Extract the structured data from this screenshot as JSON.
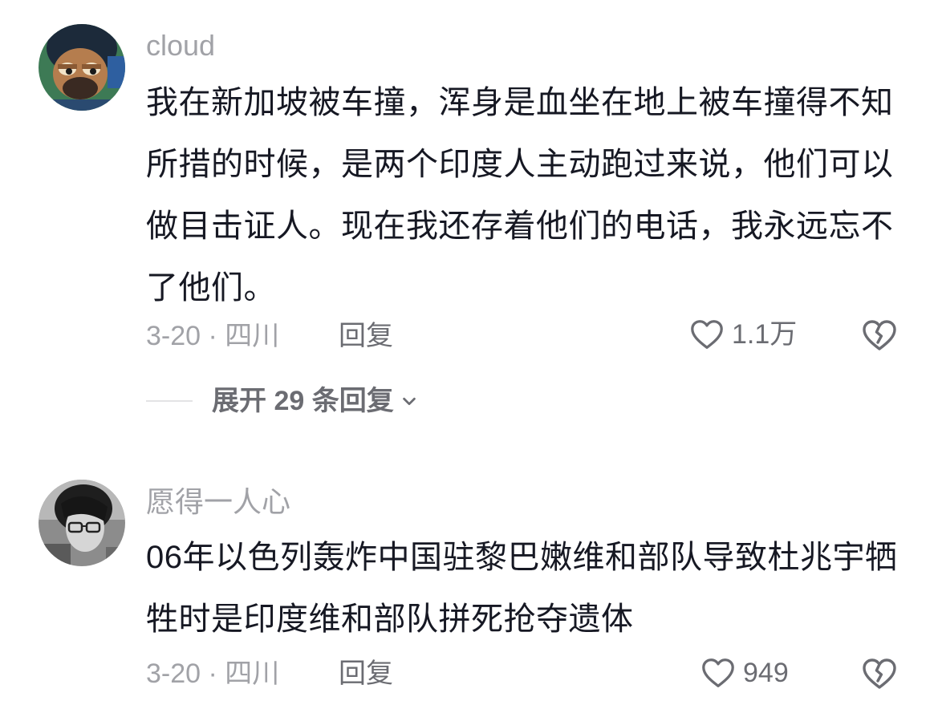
{
  "comments": [
    {
      "username": "cloud",
      "content": "我在新加坡被车撞，浑身是血坐在地上被车撞得不知所措的时候，是两个印度人主动跑过来说，他们可以做目击证人。现在我还存着他们的电话，我永远忘不了他们。",
      "meta": "3-20 · 四川",
      "reply_label": "回复",
      "like_count": "1.1万",
      "like_icon": "heart-outline-icon",
      "dislike_icon": "broken-heart-icon",
      "expand_label": "展开 29 条回复"
    },
    {
      "username": "愿得一人心",
      "content": "06年以色列轰炸中国驻黎巴嫩维和部队导致杜兆宇牺牲时是印度维和部队拼死抢夺遗体",
      "meta": "3-20 · 四川",
      "reply_label": "回复",
      "like_count": "949",
      "like_icon": "heart-outline-icon",
      "dislike_icon": "broken-heart-icon"
    }
  ],
  "colors": {
    "primary_text": "#161823",
    "secondary_text": "#a1a2a7",
    "action_text": "#6b6c72",
    "background": "#ffffff"
  }
}
